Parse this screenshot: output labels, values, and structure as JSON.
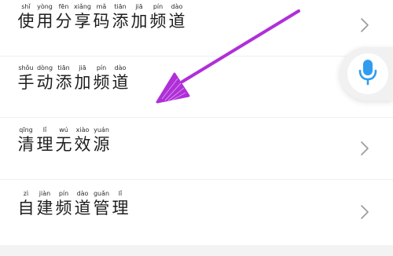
{
  "menu": {
    "items": [
      {
        "chars": [
          {
            "hanzi": "使",
            "pinyin": "shǐ"
          },
          {
            "hanzi": "用",
            "pinyin": "yòng"
          },
          {
            "hanzi": "分",
            "pinyin": "fēn"
          },
          {
            "hanzi": "享",
            "pinyin": "xiǎng"
          },
          {
            "hanzi": "码",
            "pinyin": "mǎ"
          },
          {
            "hanzi": "添",
            "pinyin": "tiān"
          },
          {
            "hanzi": "加",
            "pinyin": "jiā"
          },
          {
            "hanzi": "频",
            "pinyin": "pín"
          },
          {
            "hanzi": "道",
            "pinyin": "dào"
          }
        ]
      },
      {
        "chars": [
          {
            "hanzi": "手",
            "pinyin": "shǒu"
          },
          {
            "hanzi": "动",
            "pinyin": "dòng"
          },
          {
            "hanzi": "添",
            "pinyin": "tiān"
          },
          {
            "hanzi": "加",
            "pinyin": "jiā"
          },
          {
            "hanzi": "频",
            "pinyin": "pín"
          },
          {
            "hanzi": "道",
            "pinyin": "dào"
          }
        ]
      },
      {
        "chars": [
          {
            "hanzi": "清",
            "pinyin": "qīng"
          },
          {
            "hanzi": "理",
            "pinyin": "lǐ"
          },
          {
            "hanzi": "无",
            "pinyin": "wú"
          },
          {
            "hanzi": "效",
            "pinyin": "xiào"
          },
          {
            "hanzi": "源",
            "pinyin": "yuán"
          }
        ]
      },
      {
        "chars": [
          {
            "hanzi": "自",
            "pinyin": "zì"
          },
          {
            "hanzi": "建",
            "pinyin": "jiàn"
          },
          {
            "hanzi": "频",
            "pinyin": "pín"
          },
          {
            "hanzi": "道",
            "pinyin": "dào"
          },
          {
            "hanzi": "管",
            "pinyin": "guǎn"
          },
          {
            "hanzi": "理",
            "pinyin": "lǐ"
          }
        ]
      }
    ]
  },
  "icons": {
    "chevron": "chevron-right-icon",
    "mic": "microphone-icon",
    "annotation": "arrow-annotation"
  },
  "colors": {
    "mic_accent": "#2f9cf0",
    "arrow": "#b02fd8",
    "chevron": "#9a9a9a"
  }
}
